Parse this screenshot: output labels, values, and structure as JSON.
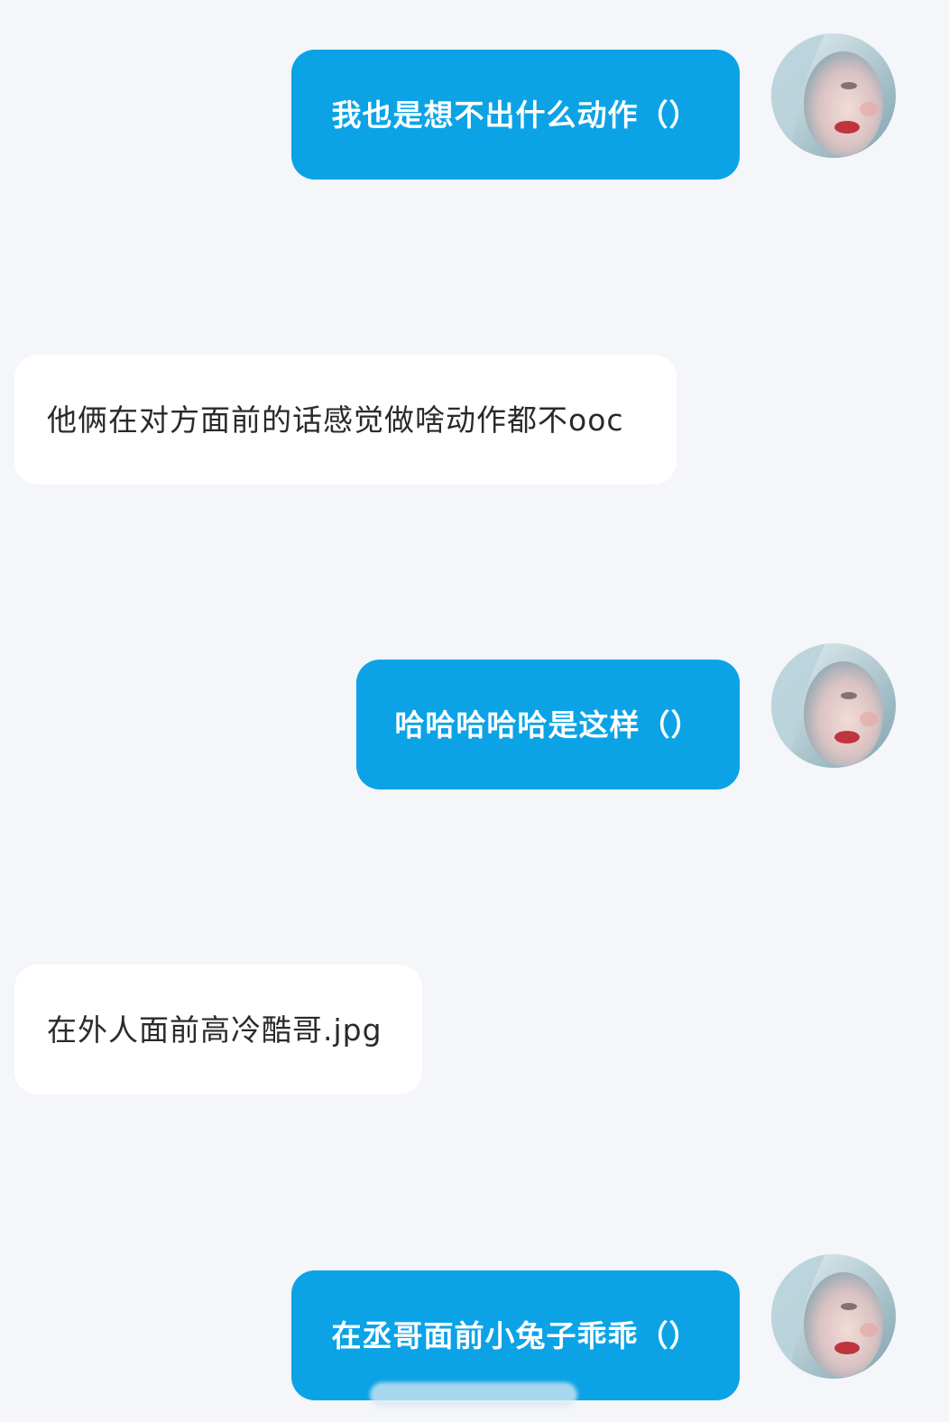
{
  "messages": [
    {
      "side": "outgoing",
      "text": "我也是想不出什么动作（）"
    },
    {
      "side": "incoming",
      "text": "他俩在对方面前的话感觉做啥动作都不ooc"
    },
    {
      "side": "outgoing",
      "text": "哈哈哈哈哈是这样（）"
    },
    {
      "side": "incoming",
      "text": "在外人面前高冷酷哥.jpg"
    },
    {
      "side": "outgoing",
      "text": "在丞哥面前小兔子乖乖（）"
    }
  ],
  "colors": {
    "background": "#f4f6f9",
    "outgoing_bubble": "#0ba3e6",
    "incoming_bubble": "#ffffff"
  },
  "icons": {
    "avatar": "user-avatar-portrait"
  }
}
